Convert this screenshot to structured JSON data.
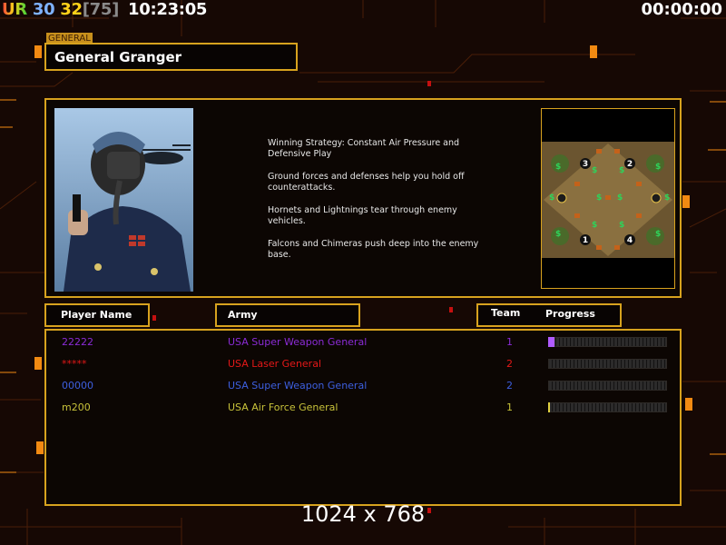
{
  "hud": {
    "ur_label": "UR",
    "stat_1": "30",
    "stat_2": "32",
    "stat_bracket": "[75]",
    "clock": "10:23:05",
    "timer": "00:00:00"
  },
  "general": {
    "tag": "GENERAL",
    "name": "General Granger"
  },
  "strategy": {
    "p1": "Winning Strategy: Constant Air Pressure and\n Defensive Play",
    "p2": "Ground forces and defenses help you hold off\n counterattacks.",
    "p3": "Hornets and Lightnings tear through enemy\n vehicles.",
    "p4": "Falcons and Chimeras push deep into the enemy\n base."
  },
  "minimap": {
    "slots": [
      "1",
      "2",
      "3",
      "4"
    ]
  },
  "columns": {
    "player_name": "Player Name",
    "army": "Army",
    "team": "Team",
    "progress": "Progress"
  },
  "players": [
    {
      "name": "22222",
      "army": "USA Super Weapon General",
      "team": "1",
      "progress": 0.05,
      "color": "#8b2bd6"
    },
    {
      "name": "*****",
      "army": "USA Laser General",
      "team": "2",
      "progress": 0.0,
      "color": "#e41818"
    },
    {
      "name": "00000",
      "army": "USA Super Weapon General",
      "team": "2",
      "progress": 0.0,
      "color": "#3d5fe0"
    },
    {
      "name": "m200",
      "army": "USA Air Force General",
      "team": "1",
      "progress": 0.015,
      "color": "#c8c23a"
    }
  ],
  "resolution": "1024 x 768"
}
